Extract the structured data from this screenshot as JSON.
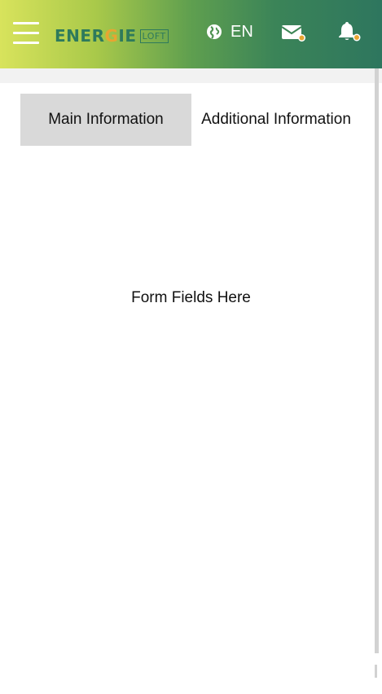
{
  "header": {
    "logo": {
      "word_before": "ENER",
      "word_highlight": "G",
      "word_after": "IE",
      "box_text": "LOFT"
    },
    "language": {
      "icon": "globe-icon",
      "label": "EN"
    },
    "icons": {
      "menu": "hamburger-menu-icon",
      "mail": "mail-icon",
      "bell": "bell-icon"
    },
    "colors": {
      "gradient_start": "#d8e35c",
      "gradient_end": "#2e765e",
      "notification_dot": "#e8a531"
    }
  },
  "tabs": [
    {
      "label": "Main Information",
      "active": true
    },
    {
      "label": "Additional Information",
      "active": false
    }
  ],
  "content": {
    "placeholder": "Form Fields Here"
  }
}
